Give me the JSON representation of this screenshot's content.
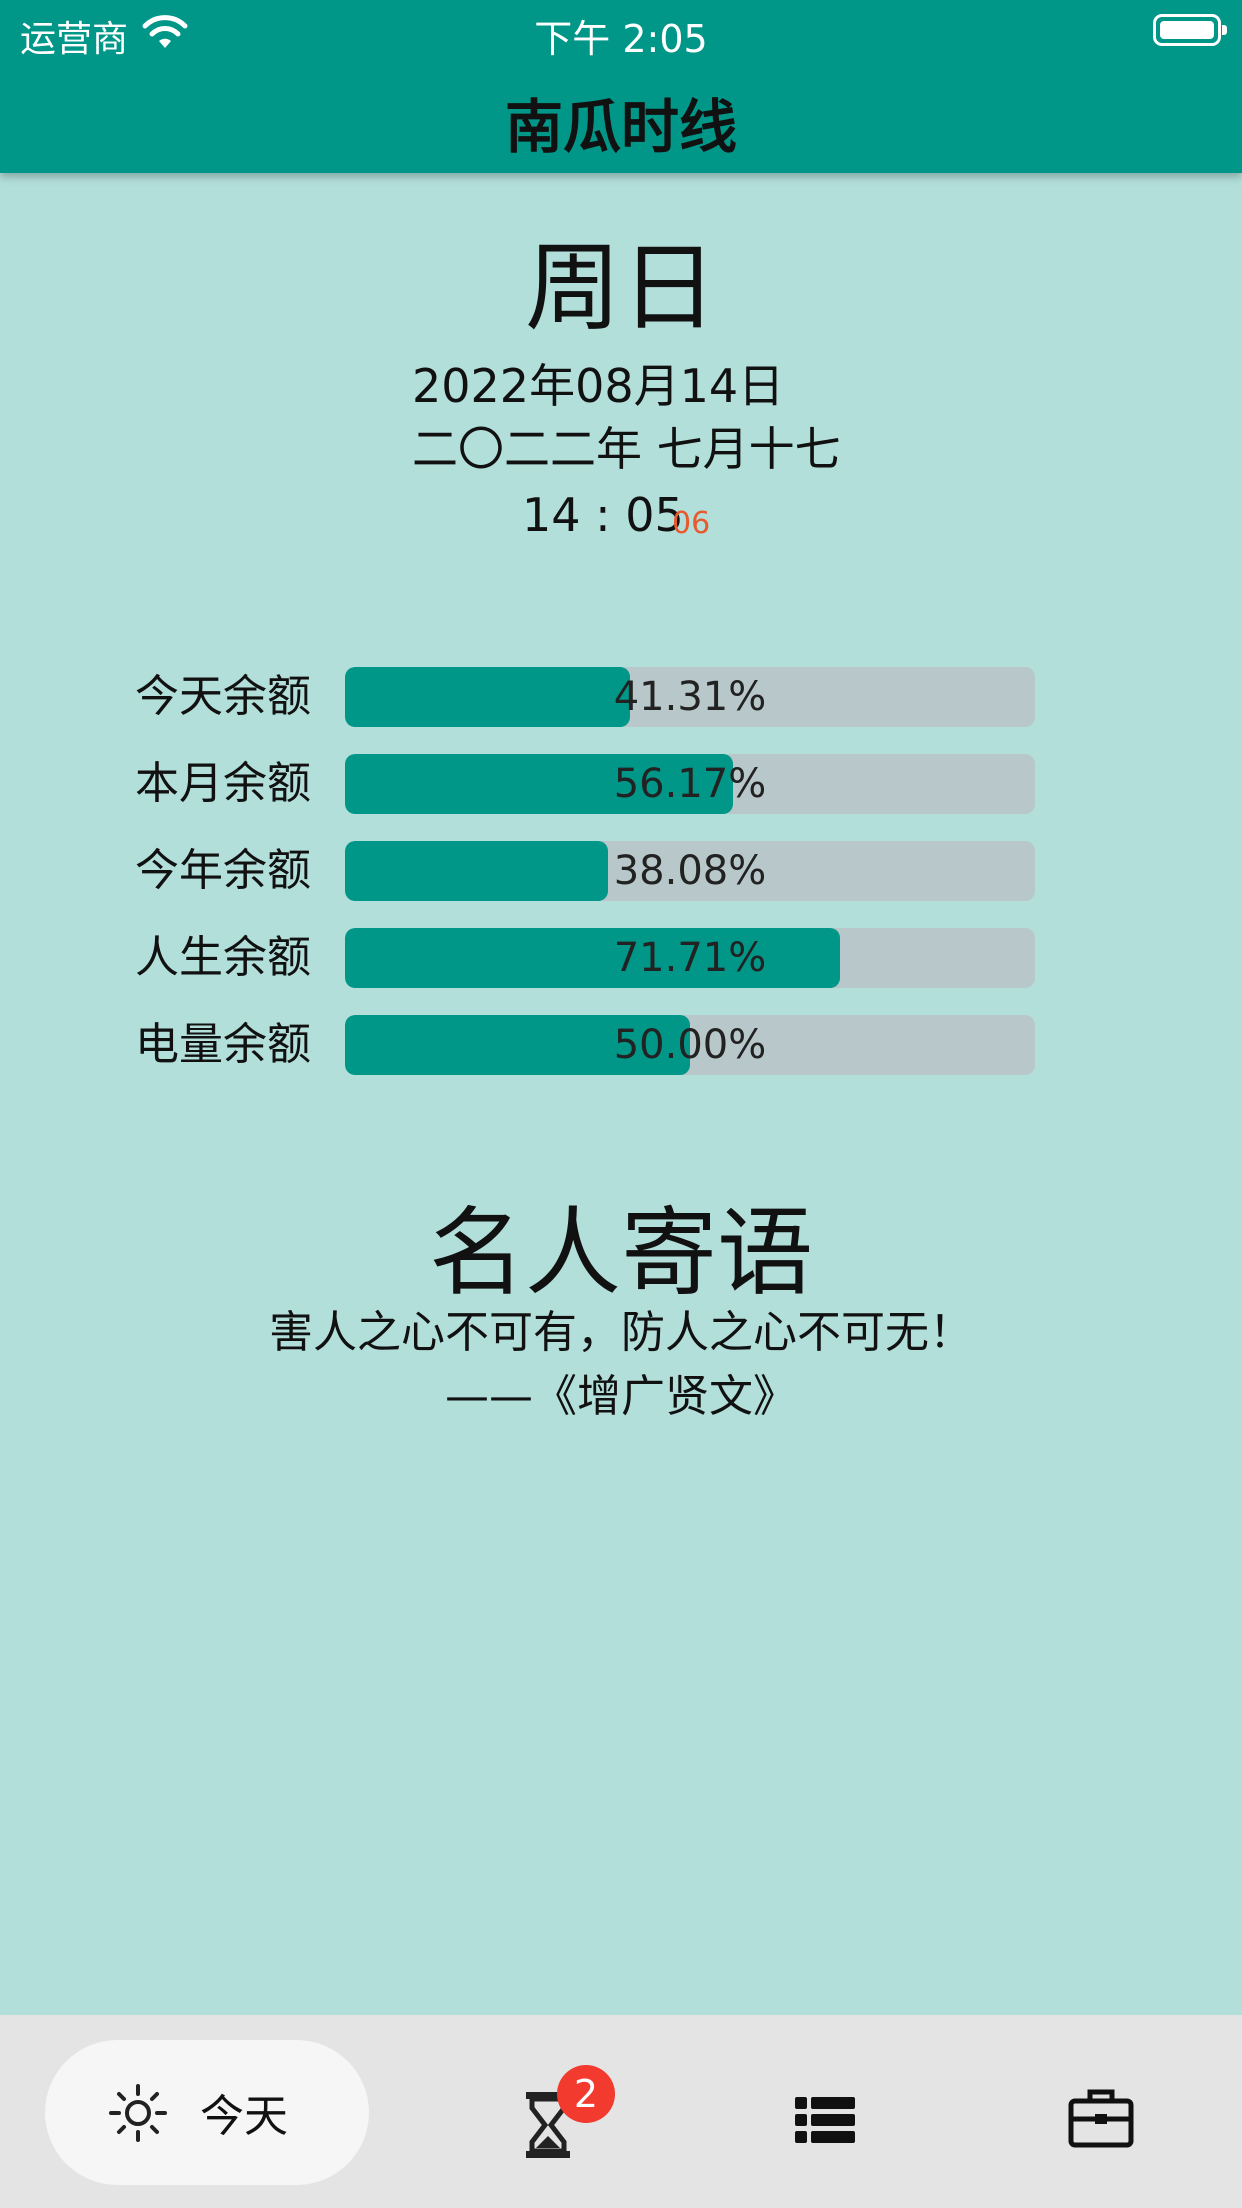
{
  "status_bar": {
    "carrier": "运营商",
    "time": "下午 2:05"
  },
  "header": {
    "title": "南瓜时线"
  },
  "today": {
    "weekday": "周日",
    "date": "2022年08月14日",
    "lunar_date": "二〇二二年 七月十七",
    "time": "14 : 05",
    "seconds": "06"
  },
  "stats": [
    {
      "label": "今天余额",
      "value_text": "41.31%",
      "fraction": 0.4131
    },
    {
      "label": "本月余额",
      "value_text": "56.17%",
      "fraction": 0.5617
    },
    {
      "label": "今年余额",
      "value_text": "38.08%",
      "fraction": 0.3808
    },
    {
      "label": "人生余额",
      "value_text": "71.71%",
      "fraction": 0.7171
    },
    {
      "label": "电量余额",
      "value_text": "50.00%",
      "fraction": 0.5
    }
  ],
  "quote": {
    "title": "名人寄语",
    "text": "害人之心不可有，防人之心不可无！",
    "source": "——《增广贤文》"
  },
  "bottom_nav": {
    "today_label": "今天",
    "timer_badge": "2",
    "icons": [
      "sun-icon",
      "hourglass-icon",
      "list-icon",
      "briefcase-icon"
    ]
  },
  "colors": {
    "primary": "#009688",
    "background": "#b3dfdb",
    "track": "#b8c8ca",
    "seconds": "#e8592b",
    "badge": "#f23a2f"
  }
}
